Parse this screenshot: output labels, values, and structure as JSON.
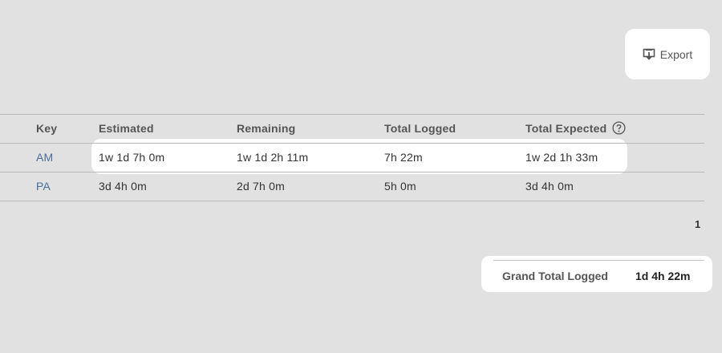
{
  "toolbar": {
    "export_label": "Export",
    "export_icon": "download-icon"
  },
  "table": {
    "columns": {
      "key": "Key",
      "estimated": "Estimated",
      "remaining": "Remaining",
      "total_logged": "Total Logged",
      "total_expected": "Total Expected"
    },
    "rows": [
      {
        "key": "AM",
        "estimated": "1w 1d 7h 0m",
        "remaining": "1w 1d 2h 11m",
        "total_logged": "7h 22m",
        "total_expected": "1w 2d 1h 33m"
      },
      {
        "key": "PA",
        "estimated": "3d 4h 0m",
        "remaining": "2d 7h 0m",
        "total_logged": "5h 0m",
        "total_expected": "3d 4h 0m"
      }
    ]
  },
  "pagination": {
    "current_page": "1"
  },
  "summary": {
    "grand_total_label": "Grand Total Logged",
    "grand_total_value": "1d 4h 22m"
  },
  "colors": {
    "background": "#e1e1e1",
    "link": "#4a6d99",
    "highlight": "#ffffff"
  }
}
